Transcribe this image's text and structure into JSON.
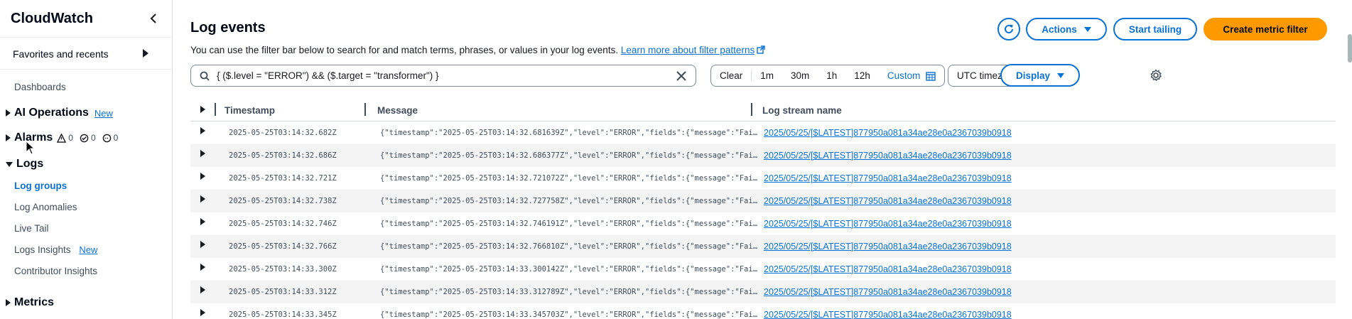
{
  "sidebar": {
    "title": "CloudWatch",
    "favorites_label": "Favorites and recents",
    "dashboards": "Dashboards",
    "ai_operations": "AI Operations",
    "ai_operations_badge": "New",
    "alarms": "Alarms",
    "alarm_counts": {
      "alarm": "0",
      "ok": "0",
      "insufficient": "0"
    },
    "logs": "Logs",
    "log_groups": "Log groups",
    "log_anomalies": "Log Anomalies",
    "live_tail": "Live Tail",
    "logs_insights": "Logs Insights",
    "logs_insights_badge": "New",
    "contributor_insights": "Contributor Insights",
    "metrics": "Metrics"
  },
  "header": {
    "title": "Log events",
    "description": "You can use the filter bar below to search for and match terms, phrases, or values in your log events.",
    "learn_more": "Learn more about filter patterns",
    "actions_label": "Actions",
    "start_tailing_label": "Start tailing",
    "create_metric_filter_label": "Create metric filter"
  },
  "filter": {
    "value": "{ ($.level = \"ERROR\") && ($.target = \"transformer\") }",
    "placeholder": ""
  },
  "time_range": {
    "clear": "Clear",
    "options": [
      "1m",
      "30m",
      "1h",
      "12h"
    ],
    "custom": "Custom"
  },
  "timezone": {
    "selected": "UTC timezone"
  },
  "display_label": "Display",
  "table": {
    "columns": [
      "Timestamp",
      "Message",
      "Log stream name"
    ],
    "rows": [
      {
        "timestamp": "2025-05-25T03:14:32.682Z",
        "message": "{\"timestamp\":\"2025-05-25T03:14:32.681639Z\",\"level\":\"ERROR\",\"fields\":{\"message\":\"Failed to process",
        "stream": "2025/05/25/[$LATEST]877950a081a34ae28e0a2367039b0918"
      },
      {
        "timestamp": "2025-05-25T03:14:32.686Z",
        "message": "{\"timestamp\":\"2025-05-25T03:14:32.686377Z\",\"level\":\"ERROR\",\"fields\":{\"message\":\"Failed to process",
        "stream": "2025/05/25/[$LATEST]877950a081a34ae28e0a2367039b0918"
      },
      {
        "timestamp": "2025-05-25T03:14:32.721Z",
        "message": "{\"timestamp\":\"2025-05-25T03:14:32.721072Z\",\"level\":\"ERROR\",\"fields\":{\"message\":\"Failed to process",
        "stream": "2025/05/25/[$LATEST]877950a081a34ae28e0a2367039b0918"
      },
      {
        "timestamp": "2025-05-25T03:14:32.738Z",
        "message": "{\"timestamp\":\"2025-05-25T03:14:32.727758Z\",\"level\":\"ERROR\",\"fields\":{\"message\":\"Failed to process",
        "stream": "2025/05/25/[$LATEST]877950a081a34ae28e0a2367039b0918"
      },
      {
        "timestamp": "2025-05-25T03:14:32.746Z",
        "message": "{\"timestamp\":\"2025-05-25T03:14:32.746191Z\",\"level\":\"ERROR\",\"fields\":{\"message\":\"Failed to process",
        "stream": "2025/05/25/[$LATEST]877950a081a34ae28e0a2367039b0918"
      },
      {
        "timestamp": "2025-05-25T03:14:32.766Z",
        "message": "{\"timestamp\":\"2025-05-25T03:14:32.766810Z\",\"level\":\"ERROR\",\"fields\":{\"message\":\"Failed to process",
        "stream": "2025/05/25/[$LATEST]877950a081a34ae28e0a2367039b0918"
      },
      {
        "timestamp": "2025-05-25T03:14:33.300Z",
        "message": "{\"timestamp\":\"2025-05-25T03:14:33.300142Z\",\"level\":\"ERROR\",\"fields\":{\"message\":\"Failed to process",
        "stream": "2025/05/25/[$LATEST]877950a081a34ae28e0a2367039b0918"
      },
      {
        "timestamp": "2025-05-25T03:14:33.312Z",
        "message": "{\"timestamp\":\"2025-05-25T03:14:33.312789Z\",\"level\":\"ERROR\",\"fields\":{\"message\":\"Failed to process",
        "stream": "2025/05/25/[$LATEST]877950a081a34ae28e0a2367039b0918"
      },
      {
        "timestamp": "2025-05-25T03:14:33.345Z",
        "message": "{\"timestamp\":\"2025-05-25T03:14:33.345703Z\",\"level\":\"ERROR\",\"fields\":{\"message\":\"Failed to process",
        "stream": "2025/05/25/[$LATEST]877950a081a34ae28e0a2367039b0918"
      }
    ]
  },
  "colors": {
    "accent": "#0972d3",
    "primary_button": "#ff9900",
    "text": "#16191f"
  }
}
